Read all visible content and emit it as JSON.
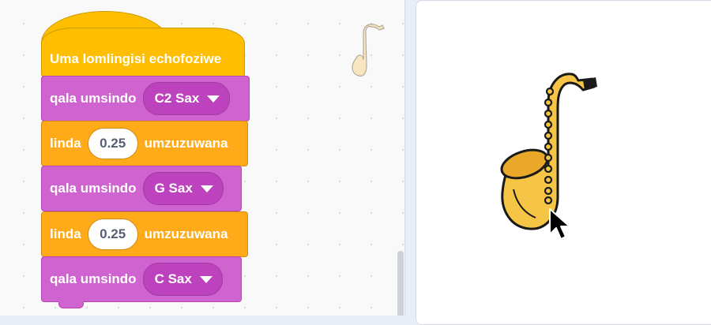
{
  "code_area": {
    "hat_block": {
      "label": "Uma lomlingisi echofoziwe"
    },
    "blocks": [
      {
        "type": "sound",
        "label": "qala umsindo",
        "dropdown_value": "C2 Sax"
      },
      {
        "type": "wait",
        "label": "linda",
        "input_value": "0.25",
        "suffix": "umzuzuwana"
      },
      {
        "type": "sound",
        "label": "qala umsindo",
        "dropdown_value": "G Sax"
      },
      {
        "type": "wait",
        "label": "linda",
        "input_value": "0.25",
        "suffix": "umzuzuwana"
      },
      {
        "type": "sound",
        "label": "qala umsindo",
        "dropdown_value": "C Sax"
      }
    ],
    "sprite_thumbnail_icon": "saxophone-icon"
  },
  "stage": {
    "sprite_icon": "saxophone-icon",
    "cursor_icon": "mouse-pointer-icon"
  },
  "colors": {
    "events": "#ffbf00",
    "sound": "#cf63cf",
    "control": "#ffab19",
    "sax_body": "#f7c545"
  }
}
